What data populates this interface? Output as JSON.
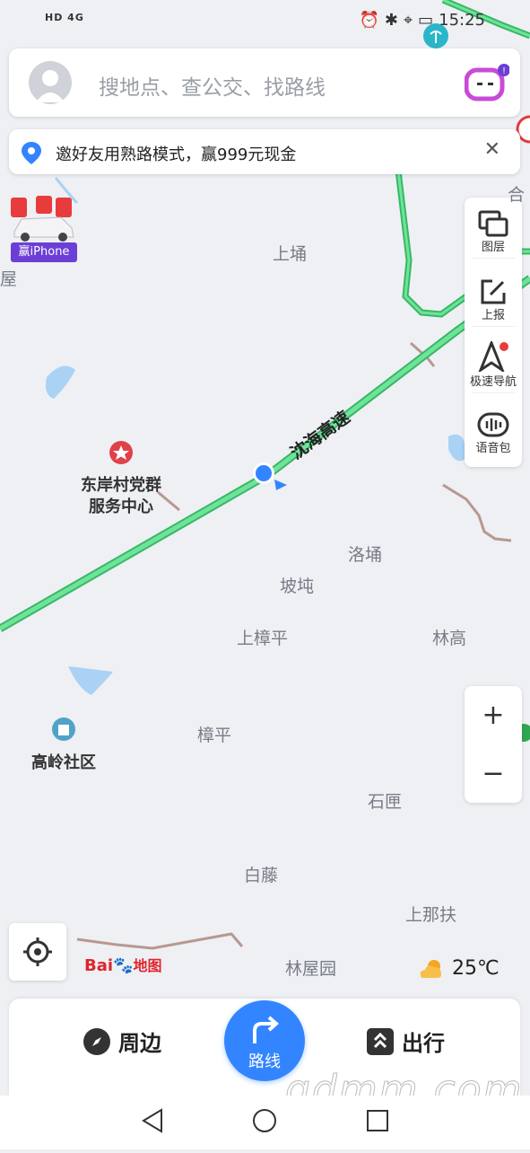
{
  "status_bar": {
    "network": "HD 4G",
    "time": "15:25"
  },
  "search": {
    "placeholder": "搜地点、查公交、找路线"
  },
  "banner": {
    "text": "邀好友用熟路模式，赢999元现金",
    "close": "✕"
  },
  "promo": {
    "tag": "赢iPhone"
  },
  "tools": [
    {
      "label": "图层"
    },
    {
      "label": "上报"
    },
    {
      "label": "极速导航"
    },
    {
      "label": "语音包"
    }
  ],
  "zoom": {
    "in": "+",
    "out": "−"
  },
  "road": {
    "name": "沈海高速"
  },
  "places": {
    "shangyong": "上埇",
    "luoyong": "洛埇",
    "podun": "坡坉",
    "shangzhangping": "上樟平",
    "lingao": "林高",
    "zhangping": "樟平",
    "shixia": "石匣",
    "baiteng": "白藤",
    "shangnafu": "上那扶",
    "linwuyuan": "林屋园",
    "wu": "屋",
    "he": "合"
  },
  "pois": {
    "party_center": "东岸村党群\n服务中心",
    "community": "高岭社区"
  },
  "logo": {
    "text": "Bai地图"
  },
  "weather": {
    "temp": "25℃"
  },
  "bottom_nav": {
    "nearby": "周边",
    "route": "路线",
    "travel": "出行"
  },
  "watermark": "gdmm.com",
  "colors": {
    "accent": "#3385ff",
    "highway": "#4cd27a"
  }
}
